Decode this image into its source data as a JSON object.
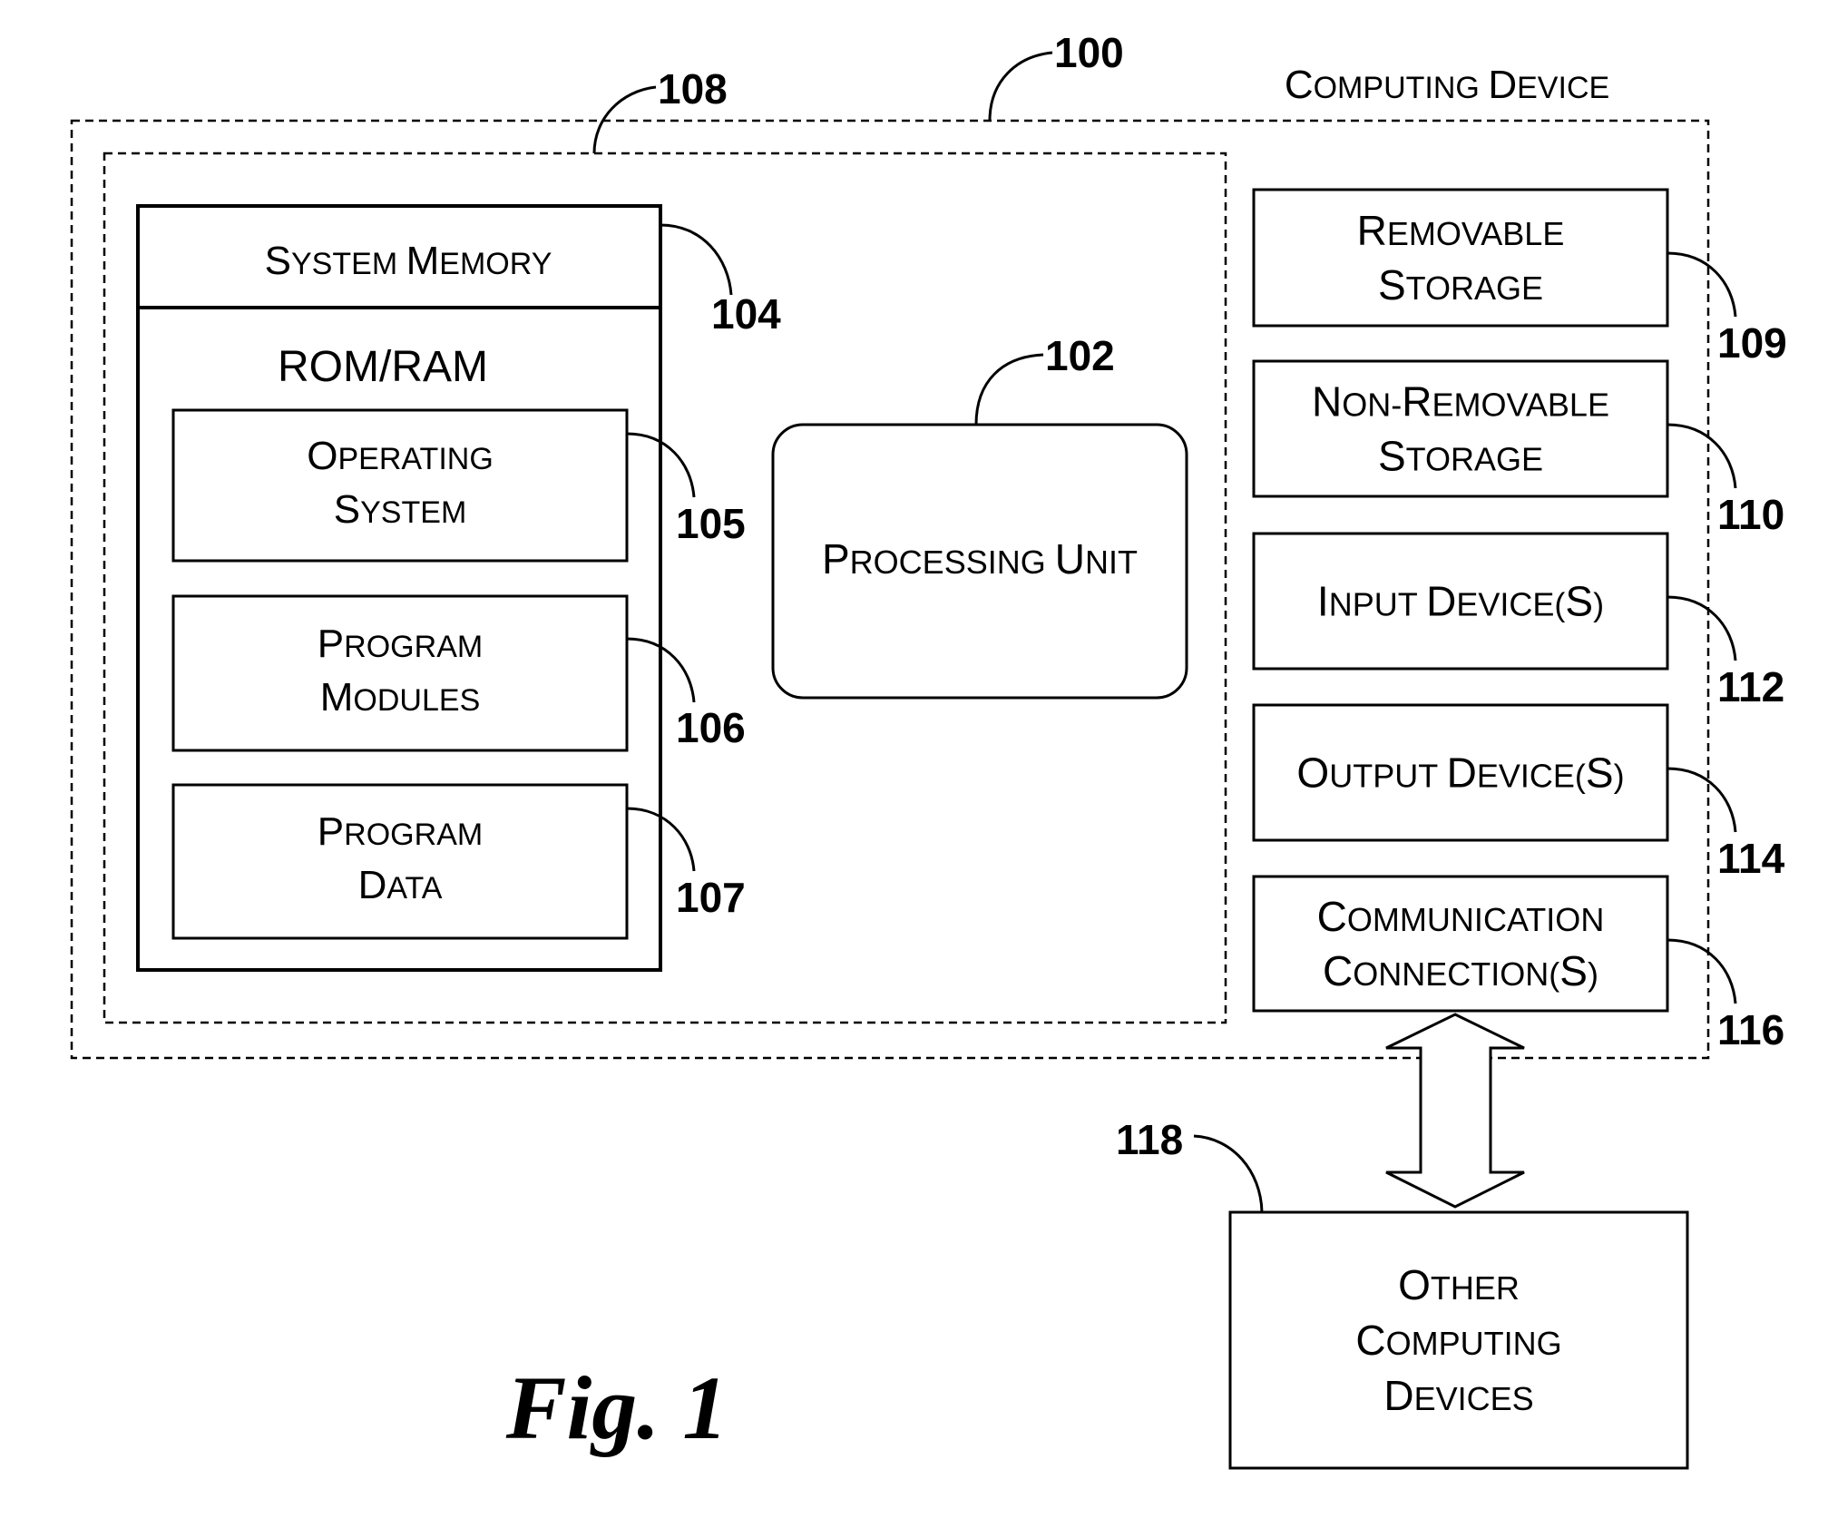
{
  "figure": {
    "caption": "Fig. 1",
    "title": "Computing Device",
    "title_ref": "100"
  },
  "containers": {
    "computing_device": {
      "ref": "100",
      "label": "Computing Device",
      "style": "dashed"
    },
    "basic_configuration": {
      "ref": "108",
      "style": "dashed"
    }
  },
  "system_memory": {
    "ref": "104",
    "header": "System Memory",
    "subheader": "ROM/RAM",
    "items": [
      {
        "ref": "105",
        "lines": [
          "Operating",
          "System"
        ]
      },
      {
        "ref": "106",
        "lines": [
          "Program",
          "Modules"
        ]
      },
      {
        "ref": "107",
        "lines": [
          "Program",
          "Data"
        ]
      }
    ]
  },
  "processing_unit": {
    "ref": "102",
    "label": "Processing Unit"
  },
  "peripherals": [
    {
      "ref": "109",
      "lines": [
        "Removable",
        "Storage"
      ]
    },
    {
      "ref": "110",
      "lines": [
        "Non-Removable",
        "Storage"
      ]
    },
    {
      "ref": "112",
      "lines": [
        "Input Device(s)"
      ]
    },
    {
      "ref": "114",
      "lines": [
        "Output Device(s)"
      ]
    },
    {
      "ref": "116",
      "lines": [
        "Communication",
        "Connection(s)"
      ]
    }
  ],
  "connection": {
    "type": "bidirectional-arrow",
    "from": "116",
    "to": "118"
  },
  "other_devices": {
    "ref": "118",
    "lines": [
      "Other",
      "Computing",
      "Devices"
    ]
  }
}
